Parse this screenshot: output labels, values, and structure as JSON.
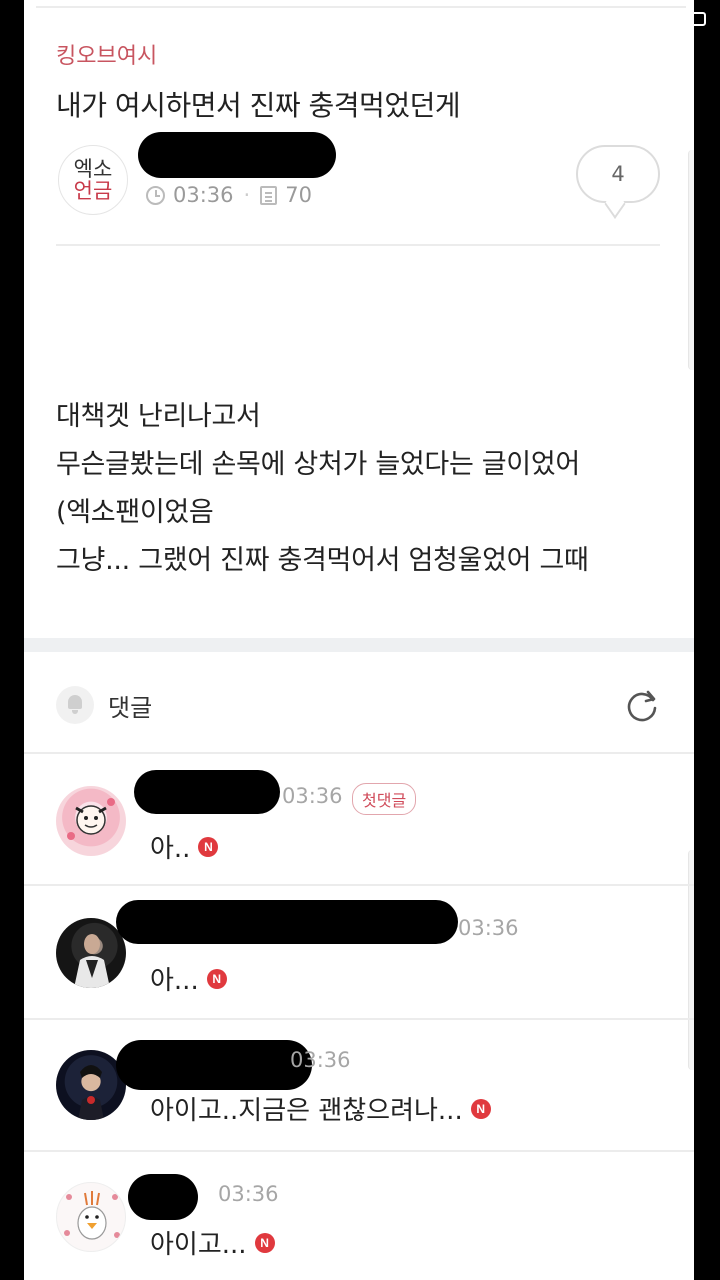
{
  "post": {
    "board": "킹오브여시",
    "title": "내가 여시하면서 진짜 충격먹었던게",
    "author_badge_line1": "엑소",
    "author_badge_line2": "언금",
    "time": "03:36",
    "views": "70",
    "comment_count": "4",
    "body_lines": [
      "대책겟 난리나고서",
      "무슨글봤는데 손목에 상처가 늘었다는 글이었어",
      "(엑소팬이었음",
      "그냥... 그랬어 진짜 충격먹어서 엄청울었어 그때"
    ]
  },
  "comments_section": {
    "label": "댓글"
  },
  "comments": [
    {
      "time": "03:36",
      "badge": "첫댓글",
      "text": "아..",
      "new": "N"
    },
    {
      "time": "03:36",
      "text": "아...",
      "new": "N"
    },
    {
      "time": "03:36",
      "text": "아이고..지금은 괜찮으려나...",
      "new": "N"
    },
    {
      "time": "03:36",
      "text": "아이고...",
      "new": "N"
    }
  ],
  "colors": {
    "accent": "#c85560",
    "new_badge": "#e0393e",
    "muted": "#a6a6a6"
  }
}
